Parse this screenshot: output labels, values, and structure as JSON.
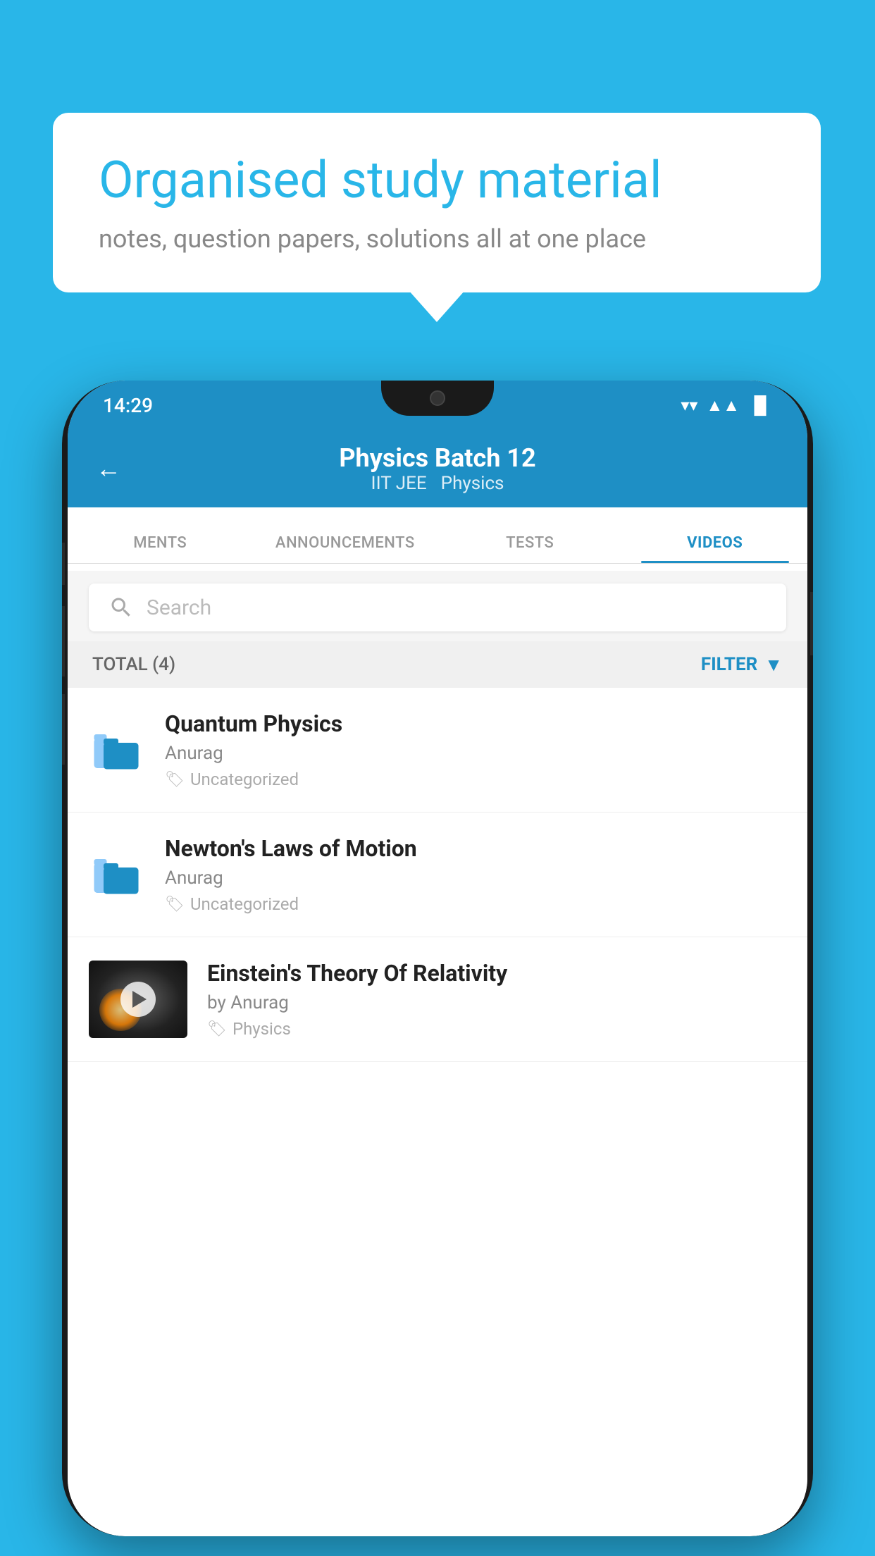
{
  "background_color": "#29B6E8",
  "speech_bubble": {
    "heading": "Organised study material",
    "subtext": "notes, question papers, solutions all at one place"
  },
  "phone": {
    "status_bar": {
      "time": "14:29",
      "wifi": "▾",
      "signal": "▲",
      "battery": "▐"
    },
    "header": {
      "back_label": "←",
      "title": "Physics Batch 12",
      "subtitle_part1": "IIT JEE",
      "subtitle_part2": "Physics"
    },
    "tabs": [
      {
        "label": "MENTS",
        "active": false
      },
      {
        "label": "ANNOUNCEMENTS",
        "active": false
      },
      {
        "label": "TESTS",
        "active": false
      },
      {
        "label": "VIDEOS",
        "active": true
      }
    ],
    "search": {
      "placeholder": "Search"
    },
    "filter_bar": {
      "total_label": "TOTAL (4)",
      "filter_label": "FILTER"
    },
    "videos": [
      {
        "id": 1,
        "title": "Quantum Physics",
        "author": "Anurag",
        "tag": "Uncategorized",
        "has_thumbnail": false
      },
      {
        "id": 2,
        "title": "Newton's Laws of Motion",
        "author": "Anurag",
        "tag": "Uncategorized",
        "has_thumbnail": false
      },
      {
        "id": 3,
        "title": "Einstein's Theory Of Relativity",
        "author_prefix": "by",
        "author": "Anurag",
        "tag": "Physics",
        "has_thumbnail": true
      }
    ]
  }
}
